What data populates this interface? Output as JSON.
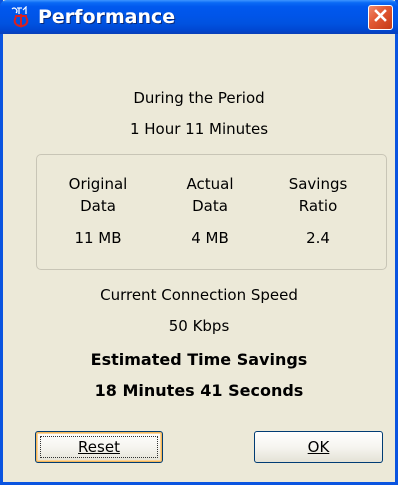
{
  "window": {
    "title": "Performance",
    "icon": "app-logo-icon",
    "close_icon": "close-icon"
  },
  "period": {
    "label": "During the Period",
    "duration": "1 Hour 11 Minutes"
  },
  "stats": {
    "original": {
      "label_line1": "Original",
      "label_line2": "Data",
      "value": "11 MB"
    },
    "actual": {
      "label_line1": "Actual",
      "label_line2": "Data",
      "value": "4 MB"
    },
    "ratio": {
      "label_line1": "Savings",
      "label_line2": "Ratio",
      "value": "2.4"
    }
  },
  "connection": {
    "label": "Current Connection Speed",
    "speed": "50 Kbps"
  },
  "savings": {
    "label": "Estimated Time Savings",
    "value": "18 Minutes 41 Seconds"
  },
  "buttons": {
    "reset": "Reset",
    "ok": "OK"
  },
  "colors": {
    "titlebar": "#0054e3",
    "window_bg": "#ece9d8",
    "close_button": "#e35a35",
    "button_border": "#003c74"
  }
}
